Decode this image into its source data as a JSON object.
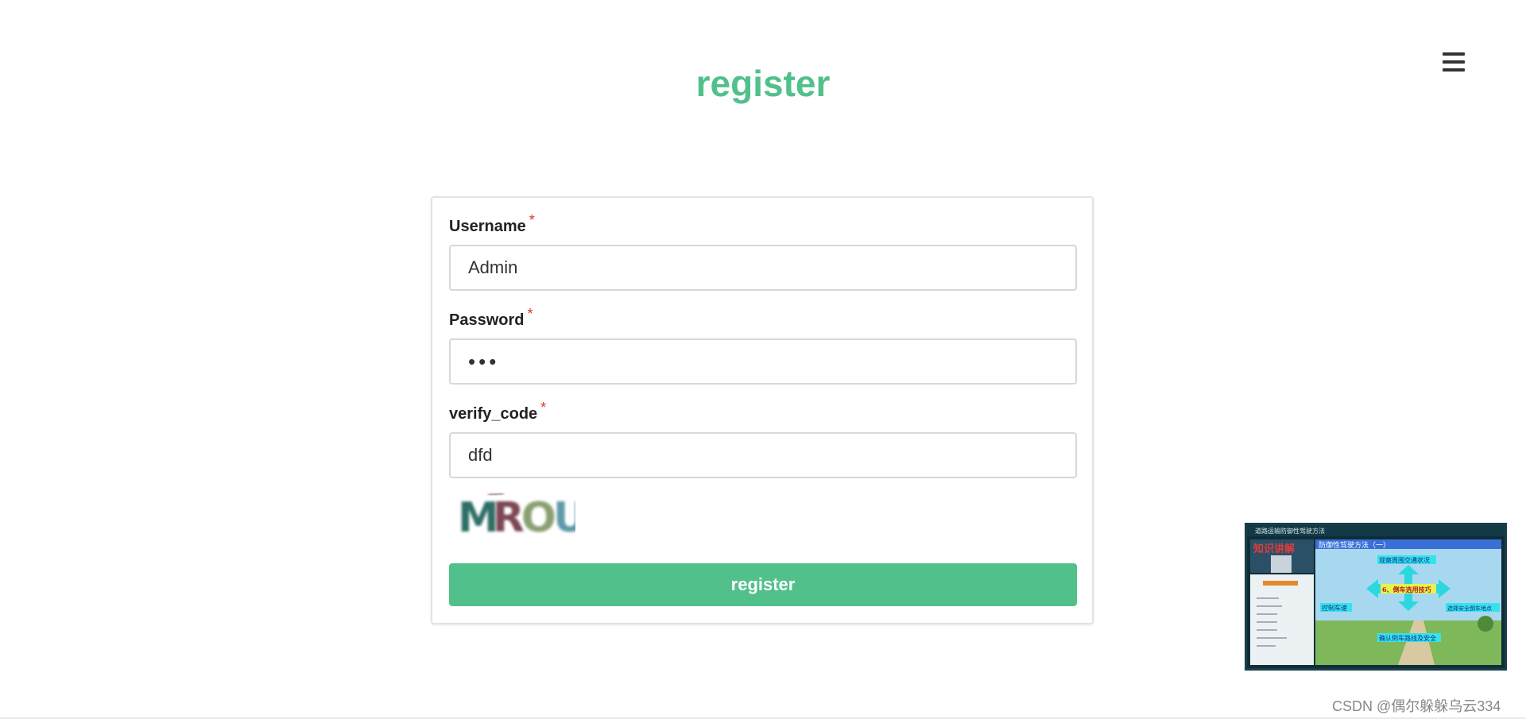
{
  "header": {
    "title": "register",
    "menu_icon": "hamburger-menu-icon"
  },
  "form": {
    "username": {
      "label": "Username",
      "required_mark": "*",
      "value": "Admin"
    },
    "password": {
      "label": "Password",
      "required_mark": "*",
      "value": "•••"
    },
    "verify_code": {
      "label": "verify_code",
      "required_mark": "*",
      "value": "dfd"
    },
    "captcha_text": "MROU",
    "submit_label": "register"
  },
  "overlay": {
    "video_thumbnail": {
      "title_bar": "道路运输防御性驾驶方法",
      "slide_title": "防御性驾驶方法（一）",
      "sidebar_heading": "知识讲解",
      "center_label": "6、倒车选用技巧",
      "top_label": "观察周围交通状况",
      "left_label": "控制车速",
      "right_label": "选择安全倒车地点",
      "bottom_label": "确认倒车路线及安全"
    },
    "watermark": "CSDN @偶尔躲躲乌云334"
  },
  "colors": {
    "accent": "#52c08b",
    "required": "#d9342b"
  }
}
